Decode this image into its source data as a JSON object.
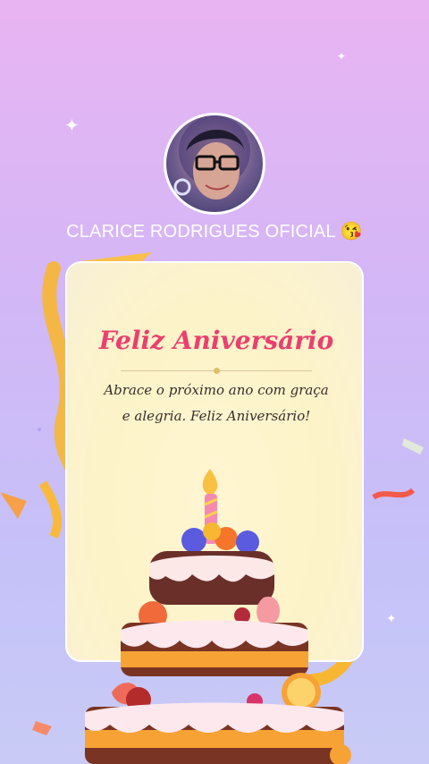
{
  "profile": {
    "name": "CLARICE RODRIGUES OFICIAL 😘"
  },
  "card": {
    "title": "Feliz Aniversário",
    "message": "Abrace o próximo ano com graça e alegria. Feliz Aniversário!"
  },
  "colors": {
    "title": "#ea3f6f",
    "background_top": "#e9b4f2",
    "background_bottom": "#c9cbf6",
    "ribbon": "#f7b733"
  },
  "icons": {
    "sparkle": "sparkle-icon",
    "cake": "birthday-cake-icon"
  }
}
